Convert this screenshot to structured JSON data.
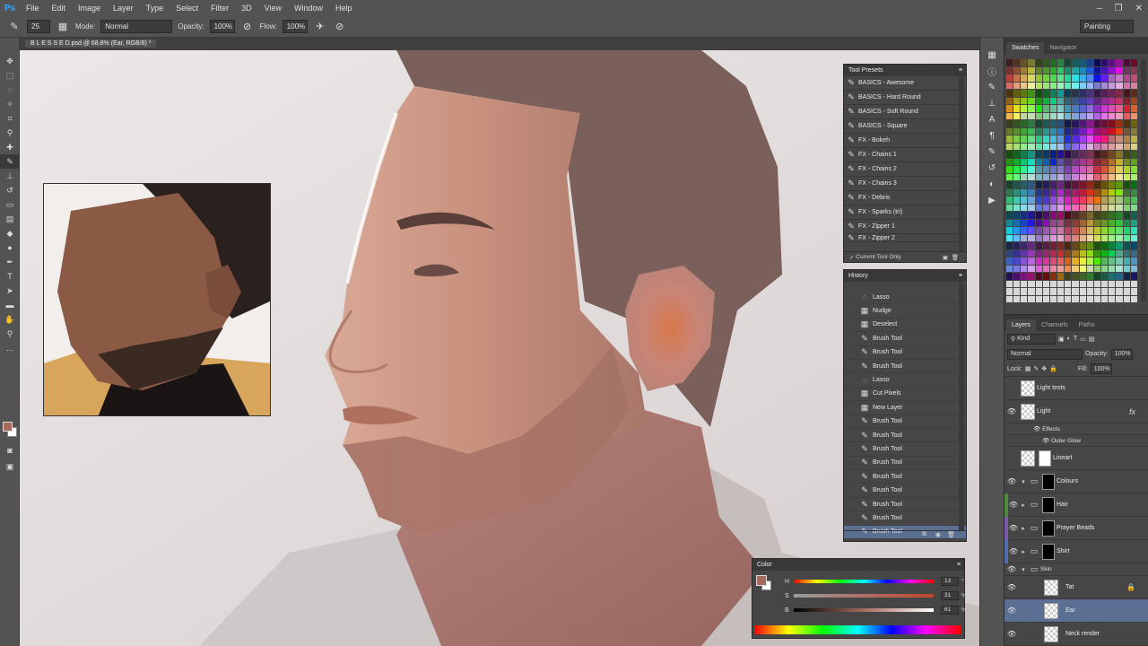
{
  "app": {
    "logo": "Ps",
    "menu": [
      "File",
      "Edit",
      "Image",
      "Layer",
      "Type",
      "Select",
      "Filter",
      "3D",
      "View",
      "Window",
      "Help"
    ],
    "window_controls": [
      "–",
      "❐",
      "✕"
    ]
  },
  "options": {
    "brush_size": "25",
    "mode_label": "Mode:",
    "mode_value": "Normal",
    "opacity_label": "Opacity:",
    "opacity_value": "100%",
    "flow_label": "Flow:",
    "flow_value": "100%",
    "workspace": "Painting"
  },
  "document": {
    "tab_title": "B L E S S E D.psd @ 68.8% (Ear, RGB/8) *"
  },
  "tool_presets": {
    "title": "Tool Presets",
    "items": [
      "BASICS - Awesome",
      "BASICS - Hard Round",
      "BASICS - Soft Round",
      "BASICS - Square",
      "FX - Bokeh",
      "FX - Chains 1",
      "FX - Chains 2",
      "FX - Chains 3",
      "FX - Debris",
      "FX - Sparks (tri)",
      "FX - Zipper 1",
      "FX - Zipper 2"
    ],
    "current_tool_only": "Current Tool Only"
  },
  "history": {
    "title": "History",
    "items": [
      {
        "label": "Lasso",
        "icon": "lasso-icon"
      },
      {
        "label": "Nudge",
        "icon": "move-icon"
      },
      {
        "label": "Deselect",
        "icon": "move-icon"
      },
      {
        "label": "Brush Tool",
        "icon": "brush-icon"
      },
      {
        "label": "Brush Tool",
        "icon": "brush-icon"
      },
      {
        "label": "Brush Tool",
        "icon": "brush-icon"
      },
      {
        "label": "Lasso",
        "icon": "lasso-icon"
      },
      {
        "label": "Cut Pixels",
        "icon": "move-icon"
      },
      {
        "label": "New Layer",
        "icon": "move-icon"
      },
      {
        "label": "Brush Tool",
        "icon": "brush-icon"
      },
      {
        "label": "Brush Tool",
        "icon": "brush-icon"
      },
      {
        "label": "Brush Tool",
        "icon": "brush-icon"
      },
      {
        "label": "Brush Tool",
        "icon": "brush-icon"
      },
      {
        "label": "Brush Tool",
        "icon": "brush-icon"
      },
      {
        "label": "Brush Tool",
        "icon": "brush-icon"
      },
      {
        "label": "Brush Tool",
        "icon": "brush-icon"
      },
      {
        "label": "Brush Tool",
        "icon": "brush-icon"
      },
      {
        "label": "Brush Tool",
        "icon": "brush-icon"
      }
    ]
  },
  "color": {
    "title": "Color",
    "h_label": "H",
    "s_label": "S",
    "b_label": "B",
    "h_value": "13",
    "s_value": "31",
    "b_value": "61",
    "h_unit": "°",
    "s_unit": "%",
    "b_unit": "%",
    "foreground": "#a66a5e",
    "background": "#ffffff"
  },
  "swatches": {
    "tabs": [
      "Swatches",
      "Navigator"
    ]
  },
  "layers": {
    "tabs": [
      "Layers",
      "Channels",
      "Paths"
    ],
    "kind_label": "Kind",
    "blend_mode": "Normal",
    "opacity_label": "Opacity:",
    "opacity_value": "100%",
    "lock_label": "Lock:",
    "fill_label": "Fill:",
    "fill_value": "100%",
    "effects_label": "Effects",
    "outer_glow_label": "Outer Glow",
    "rows": {
      "light_tests": "Light tests",
      "light": "Light",
      "lineart": "Lineart",
      "colours": "Colours",
      "hair": "Hair",
      "prayer_beads": "Prayer Beads",
      "shirt": "Shirt",
      "skin": "Skin",
      "tat": "Tat",
      "ear": "Ear",
      "neck_render": "Neck render"
    },
    "tag_colors": {
      "hair": "#4e8a3c",
      "prayer_beads": "#7a5aa8",
      "shirt": "#4f6fb0"
    }
  }
}
